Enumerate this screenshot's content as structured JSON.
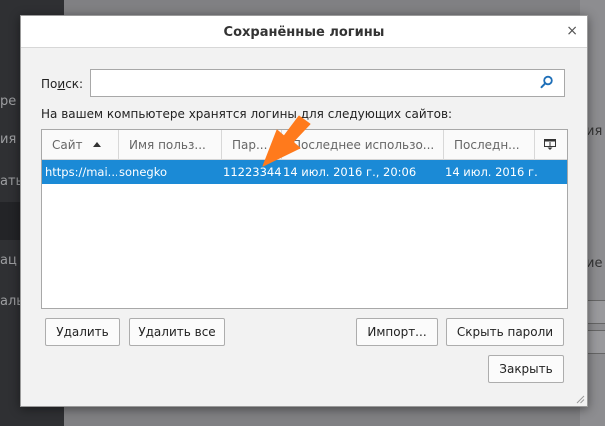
{
  "background": {
    "left_items": [
      "ре",
      "ия",
      "ать",
      "ац",
      "альн"
    ],
    "right_items": [
      "ия",
      "ие",
      "ке"
    ]
  },
  "dialog": {
    "title": "Сохранённые логины",
    "close_glyph": "×",
    "search": {
      "label_prefix": "По",
      "label_underline": "и",
      "label_suffix": "ск:",
      "value": "",
      "placeholder": ""
    },
    "info": "На вашем компьютере хранятся логины для следующих сайтов:",
    "table": {
      "columns": [
        "Сайт",
        "Имя польз...",
        "Пар...",
        "Последнее использо...",
        "Последн..."
      ],
      "rows": [
        {
          "site": "https://mai...",
          "username": "sonegko",
          "password": "11223344",
          "last_used": "14 июл. 2016 г., 20:06",
          "last_changed": "14 июл. 2016 г."
        }
      ]
    },
    "buttons": {
      "delete": "Удалить",
      "delete_all": "Удалить все",
      "import": "Импорт...",
      "hide_passwords": "Скрыть пароли",
      "close": "Закрыть"
    }
  },
  "colors": {
    "selection": "#1b8ad6",
    "annotation_arrow": "#ff7a1c"
  }
}
